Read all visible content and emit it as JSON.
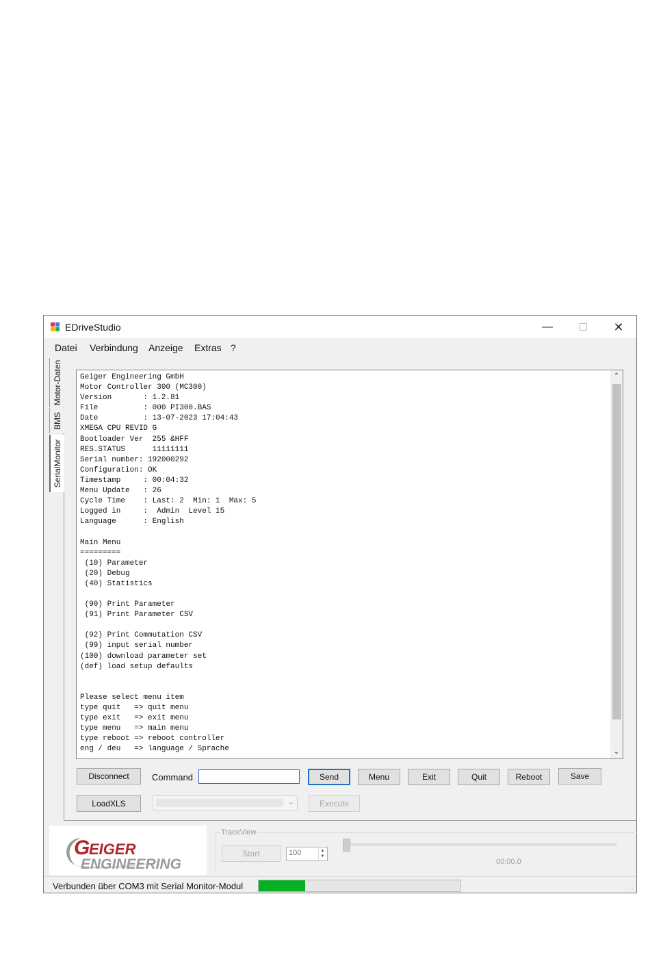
{
  "window": {
    "title": "EDriveStudio"
  },
  "menu": [
    "Datei",
    "Verbindung",
    "Anzeige",
    "Extras",
    "?"
  ],
  "side_tabs": [
    "Motor-Daten",
    "BMS",
    "SerialMonitor"
  ],
  "console": {
    "lines": [
      "Geiger Engineering GmbH",
      "Motor Controller 300 (MC300)",
      "Version       : 1.2.81",
      "File          : 000 PI300.BAS",
      "Date          : 13-07-2023 17:04:43",
      "XMEGA CPU REVID G",
      "Bootloader Ver  255 &HFF",
      "RES.STATUS      11111111",
      "Serial number: 192000292",
      "Configuration: OK",
      "Timestamp     : 00:04:32",
      "Menu Update   : 26",
      "Cycle Time    : Last: 2  Min: 1  Max: 5",
      "Logged in     :  Admin  Level 15",
      "Language      : English",
      "",
      "Main Menu",
      "=========",
      " (10) Parameter",
      " (20) Debug",
      " (40) Statistics",
      "",
      " (90) Print Parameter",
      " (91) Print Parameter CSV",
      "",
      " (92) Print Commutation CSV",
      " (99) input serial number",
      "(100) download parameter set",
      "(def) load setup defaults",
      "",
      "",
      "Please select menu item",
      "type quit   => quit menu",
      "type exit   => exit menu",
      "type menu   => main menu",
      "type reboot => reboot controller",
      "eng / deu   => language / Sprache"
    ]
  },
  "controls": {
    "disconnect": "Disconnect",
    "command_label": "Command",
    "command_value": "",
    "send": "Send",
    "menu": "Menu",
    "exit": "Exit",
    "quit": "Quit",
    "reboot": "Reboot",
    "save": "Save",
    "loadxls": "LoadXLS",
    "execute": "Execute"
  },
  "logo": {
    "line1": "GEIGER",
    "line2": "ENGINEERING"
  },
  "trace": {
    "title": "TraceView",
    "start": "Start",
    "spin_value": "100",
    "time": "00:00.0",
    "slider_position": 0
  },
  "status": {
    "text": "Verbunden über COM3 mit Serial Monitor-Modul",
    "progress": 0.23
  },
  "colors": {
    "progress_fill": "#06b025",
    "focus_blue": "#1e6fc9",
    "logo_red": "#b2242c",
    "logo_grey": "#8a8a8a"
  }
}
